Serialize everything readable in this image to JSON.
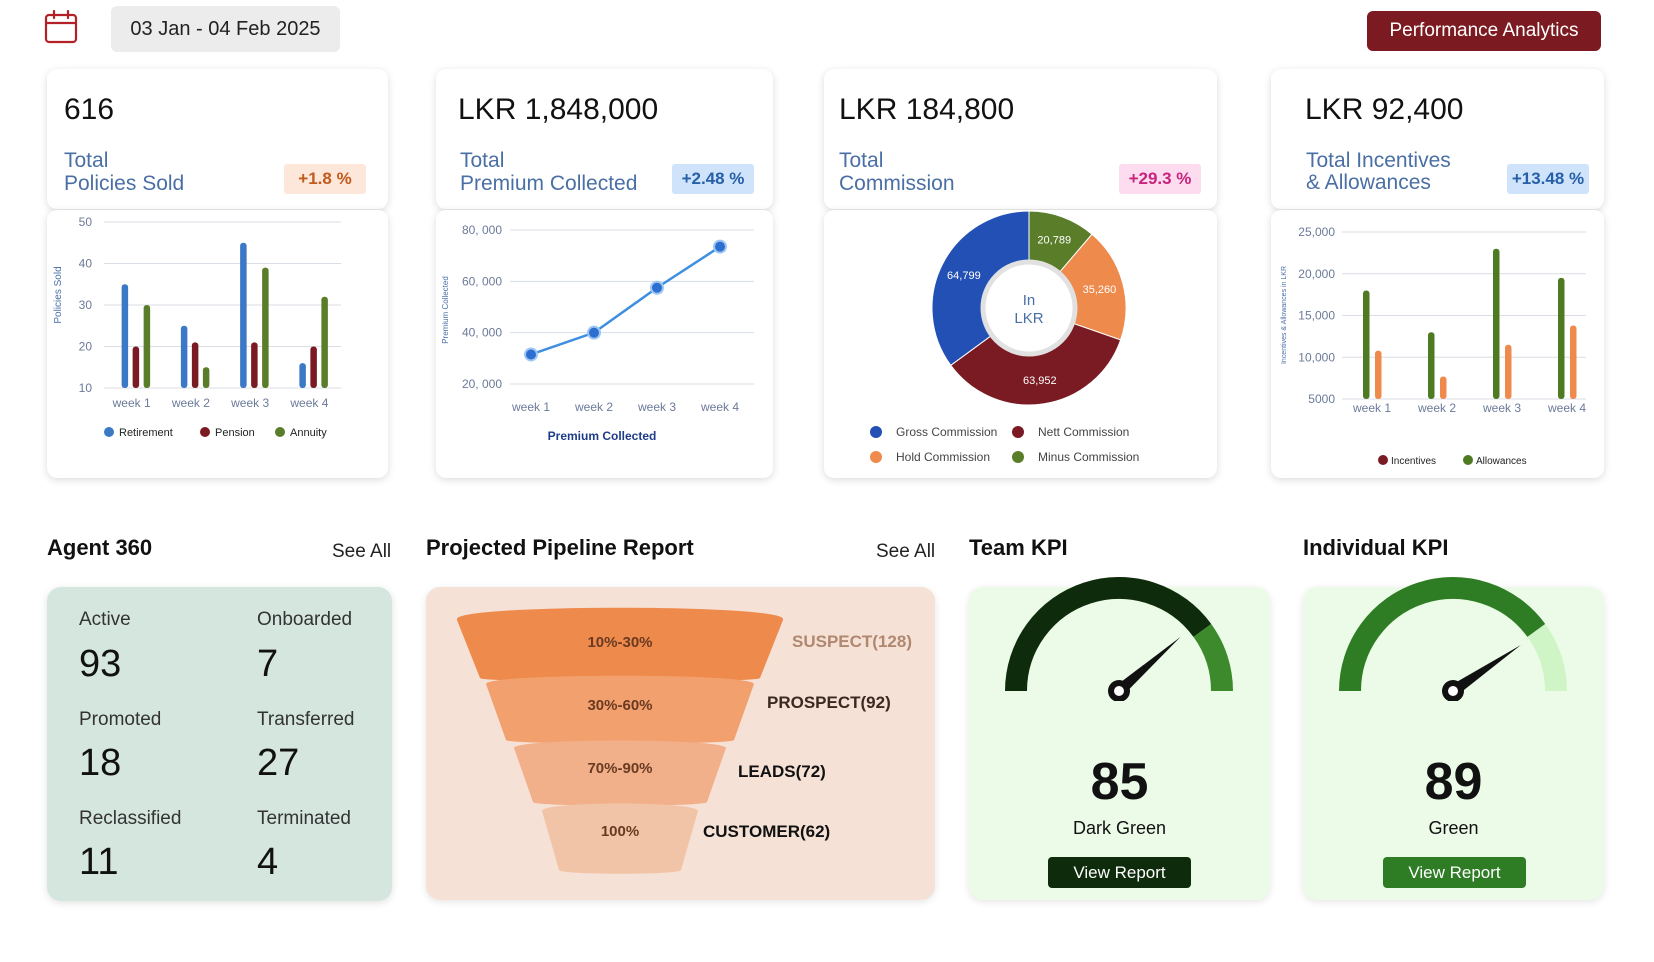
{
  "header": {
    "date_range": "03 Jan - 04 Feb 2025",
    "performance_button": "Performance Analytics"
  },
  "kpis": [
    {
      "value": "616",
      "label_line1": "Total",
      "label_line2": "Policies Sold",
      "change": "+1.8 %"
    },
    {
      "value": "LKR 1,848,000",
      "label_line1": "Total",
      "label_line2": "Premium Collected",
      "change": "+2.48 %"
    },
    {
      "value": "LKR 184,800",
      "label_line1": "Total",
      "label_line2": "Commission",
      "change": "+29.3 %"
    },
    {
      "value": "LKR 92,400",
      "label_line1": "Total Incentives",
      "label_line2": "& Allowances",
      "change": "+13.48 %"
    }
  ],
  "chart_data": [
    {
      "type": "bar",
      "ylabel": "Policies Sold",
      "categories": [
        "week 1",
        "week 2",
        "week 3",
        "week 4"
      ],
      "yticks": [
        10,
        20,
        30,
        40,
        50
      ],
      "ylim": [
        10,
        50
      ],
      "series": [
        {
          "name": "Retirement",
          "color": "#3b78c6",
          "values": [
            35,
            25,
            45,
            16
          ]
        },
        {
          "name": "Pension",
          "color": "#7a1a22",
          "values": [
            20,
            21,
            21,
            20
          ]
        },
        {
          "name": "Annuity",
          "color": "#5a7d2a",
          "values": [
            30,
            15,
            39,
            32
          ]
        }
      ],
      "legend_position": "bottom"
    },
    {
      "type": "line",
      "ylabel": "Premium Collected",
      "xlabel": "Premium Collected",
      "categories": [
        "week 1",
        "week 2",
        "week 3",
        "week 4"
      ],
      "ytick_labels": [
        "20, 000",
        "40, 000",
        "60, 000",
        "80, 000"
      ],
      "yticks": [
        20000,
        40000,
        60000,
        80000
      ],
      "ylim": [
        20000,
        80000
      ],
      "series": [
        {
          "name": "Premium Collected",
          "color": "#3f8fe0",
          "values": [
            31500,
            40000,
            57500,
            73500
          ]
        }
      ]
    },
    {
      "type": "pie",
      "center_label_line1": "In",
      "center_label_line2": "LKR",
      "slices": [
        {
          "name": "Gross Commission",
          "value": 64799,
          "label": "64,799",
          "color": "#2350b5"
        },
        {
          "name": "Nett Commission",
          "value": 63952,
          "label": "63,952",
          "color": "#7a1a22"
        },
        {
          "name": "Hold Commission",
          "value": 35260,
          "label": "35,260",
          "color": "#ee8a4c"
        },
        {
          "name": "Minus Commission",
          "value": 20789,
          "label": "20,789",
          "color": "#5a7d2a"
        }
      ],
      "slice_order": [
        "Minus Commission",
        "Hold Commission",
        "Nett Commission",
        "Gross Commission"
      ],
      "legend_position": "bottom"
    },
    {
      "type": "bar",
      "ylabel": "Incentives & Allowances in LKR",
      "categories": [
        "week 1",
        "week 2",
        "week 3",
        "week 4"
      ],
      "ytick_labels": [
        "5000",
        "10,000",
        "15,000",
        "20,000",
        "25,000"
      ],
      "yticks": [
        5000,
        10000,
        15000,
        20000,
        25000
      ],
      "ylim": [
        5000,
        25000
      ],
      "series": [
        {
          "name": "Allowances",
          "color": "#4e7a22",
          "values": [
            18000,
            13000,
            23000,
            19500
          ]
        },
        {
          "name": "Incentives",
          "color": "#ee8a4c",
          "values": [
            10800,
            7700,
            11500,
            13800
          ]
        }
      ],
      "legend_order": [
        "Incentives",
        "Allowances"
      ],
      "legend_colors": {
        "Incentives": "#7a1a22",
        "Allowances": "#4e7a22"
      },
      "legend_position": "bottom"
    }
  ],
  "agent360": {
    "title": "Agent 360",
    "see_all": "See All",
    "stats": [
      {
        "label": "Active",
        "value": "93"
      },
      {
        "label": "Onboarded",
        "value": "7"
      },
      {
        "label": "Promoted",
        "value": "18"
      },
      {
        "label": "Transferred",
        "value": "27"
      },
      {
        "label": "Reclassified",
        "value": "11"
      },
      {
        "label": "Terminated",
        "value": "4"
      }
    ]
  },
  "pipeline": {
    "title": "Projected Pipeline Report",
    "see_all": "See All",
    "stages": [
      {
        "range": "10%-30%",
        "name": "SUSPECT(128)",
        "color": "#ee8a4c"
      },
      {
        "range": "30%-60%",
        "name": "PROSPECT(92)",
        "color": "#f2a16e"
      },
      {
        "range": "70%-90%",
        "name": "LEADS(72)",
        "color": "#f1b08a"
      },
      {
        "range": "100%",
        "name": "CUSTOMER(62)",
        "color": "#f2c4a7"
      }
    ]
  },
  "team_kpi": {
    "title": "Team KPI",
    "value": 85,
    "status": "Dark Green",
    "button": "View Report",
    "color": "#0e2c0b",
    "tail_color": "#3c8a2c"
  },
  "individual_kpi": {
    "title": "Individual KPI",
    "value": 89,
    "status": "Green",
    "button": "View Report",
    "color": "#2e7d25",
    "tail_color": "#cff5c6"
  }
}
